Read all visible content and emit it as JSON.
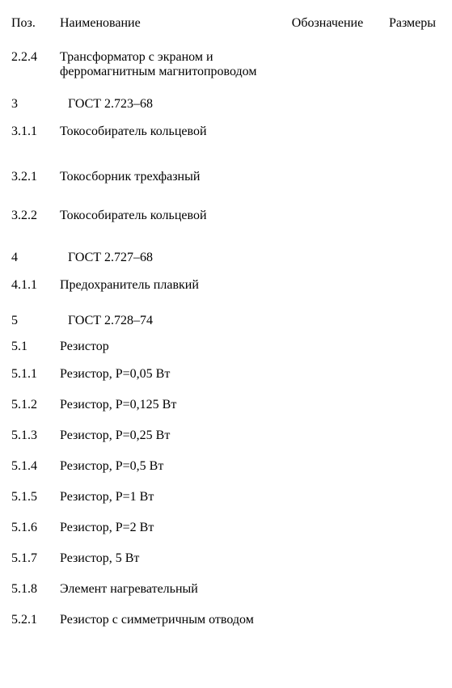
{
  "headers": {
    "pos": "Поз.",
    "name": "Наименование",
    "desig": "Обозначение",
    "size": "Размеры"
  },
  "rows": [
    {
      "pos": "2.2.4",
      "name": "Трансформатор с экраном и ферромагнитным магнитопроводом",
      "desig": "",
      "size": "",
      "gapAfter": 18
    },
    {
      "pos": "3",
      "name": "ГОСТ 2.723–68",
      "desig": "",
      "size": "",
      "gapAfter": 6,
      "indentName": true
    },
    {
      "pos": "3.1.1",
      "name": "Токособиратель кольцевой",
      "desig": "",
      "size": "",
      "gapAfter": 28
    },
    {
      "pos": "3.2.1",
      "name": "Токосборник трехфазный",
      "desig": "",
      "size": "",
      "gapAfter": 20
    },
    {
      "pos": "3.2.2",
      "name": "Токособиратель кольцевой",
      "desig": "",
      "size": "",
      "gapAfter": 24
    },
    {
      "pos": "4",
      "name": "ГОСТ 2.727–68",
      "desig": "",
      "size": "",
      "gapAfter": 6,
      "indentName": true
    },
    {
      "pos": "4.1.1",
      "name": "Предохранитель плавкий",
      "desig": "",
      "size": "",
      "gapAfter": 16
    },
    {
      "pos": "5",
      "name": "ГОСТ 2.728–74",
      "desig": "",
      "size": "",
      "gapAfter": 4,
      "indentName": true
    },
    {
      "pos": "5.1",
      "name": "Резистор",
      "desig": "",
      "size": "",
      "gapAfter": 6
    },
    {
      "pos": "5.1.1",
      "name": "Резистор, P=0,05 Вт",
      "desig": "",
      "size": "",
      "gapAfter": 10
    },
    {
      "pos": "5.1.2",
      "name": "Резистор, P=0,125 Вт",
      "desig": "",
      "size": "",
      "gapAfter": 10
    },
    {
      "pos": "5.1.3",
      "name": "Резистор, P=0,25 Вт",
      "desig": "",
      "size": "",
      "gapAfter": 10
    },
    {
      "pos": "5.1.4",
      "name": "Резистор, P=0,5 Вт",
      "desig": "",
      "size": "",
      "gapAfter": 10
    },
    {
      "pos": "5.1.5",
      "name": "Резистор, P=1 Вт",
      "desig": "",
      "size": "",
      "gapAfter": 10
    },
    {
      "pos": "5.1.6",
      "name": "Резистор, P=2 Вт",
      "desig": "",
      "size": "",
      "gapAfter": 10
    },
    {
      "pos": "5.1.7",
      "name": "Резистор, 5 Вт",
      "desig": "",
      "size": "",
      "gapAfter": 10
    },
    {
      "pos": "5.1.8",
      "name": "Элемент нагревательный",
      "desig": "",
      "size": "",
      "gapAfter": 10
    },
    {
      "pos": "5.2.1",
      "name": "Резистор с симметричным отводом",
      "desig": "",
      "size": "",
      "gapAfter": 0
    }
  ]
}
